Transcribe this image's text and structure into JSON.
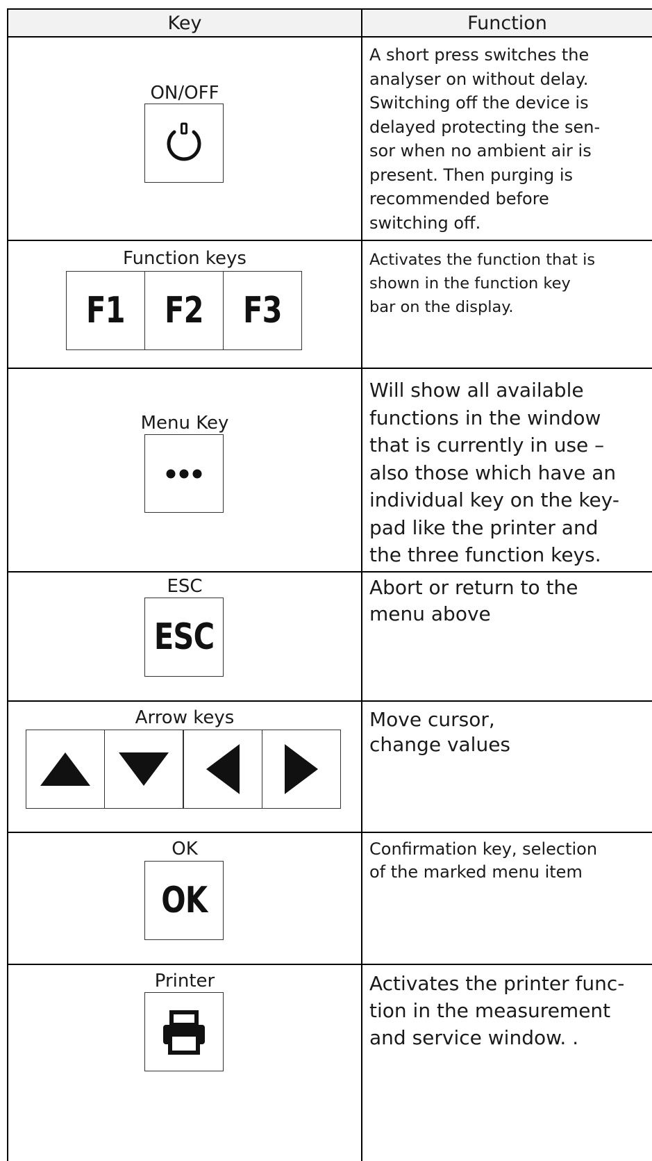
{
  "header": {
    "key": "Key",
    "function": "Function"
  },
  "rows": [
    {
      "label": "ON/OFF",
      "keys": [],
      "icon": "power-icon",
      "function_lines": [
        "A short press switches the",
        "analyser on without delay.",
        "Switching off the device is",
        "delayed protecting the sen-",
        "sor when no ambient air is",
        "present. Then purging is",
        "recommended before",
        "switching off."
      ]
    },
    {
      "label": "Function keys",
      "keys": [
        "F1",
        "F2",
        "F3"
      ],
      "function_lines": [
        "Activates the function that is",
        "shown in the function key",
        "bar on the display."
      ]
    },
    {
      "label": "Menu Key",
      "keys": [],
      "icon": "ellipsis-icon",
      "function_lines": [
        "Will show all available",
        "functions in the window",
        "that is currently in use –",
        "also those which have an",
        "individual key on the key-",
        "pad like the printer and",
        "the three function keys."
      ]
    },
    {
      "label": "ESC",
      "keys": [
        "ESC"
      ],
      "function_lines": [
        "Abort or return to the",
        "menu above"
      ]
    },
    {
      "label": "Arrow keys",
      "keys": [],
      "icons": [
        "arrow-up-icon",
        "arrow-down-icon",
        "arrow-left-icon",
        "arrow-right-icon"
      ],
      "function_lines": [
        "Move cursor,",
        "change values"
      ]
    },
    {
      "label": "OK",
      "keys": [
        "OK"
      ],
      "function_lines": [
        "Confirmation key, selection",
        "of the marked menu item"
      ]
    },
    {
      "label": "Printer",
      "keys": [],
      "icon": "printer-icon",
      "function_lines": [
        "Activates the printer func-",
        "tion in the measurement",
        "and service window. ."
      ]
    }
  ]
}
